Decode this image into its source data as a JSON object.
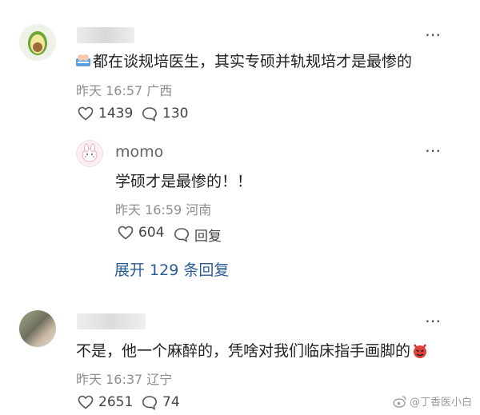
{
  "comments": [
    {
      "content": "都在谈规培医生，其实专硕并轨规培才是最惨的",
      "time": "昨天 16:57",
      "location": "广西",
      "likes": "1439",
      "comments": "130",
      "reply": {
        "username": "momo",
        "content": "学硕才是最惨的！！",
        "time": "昨天 16:59",
        "location": "河南",
        "likes": "604",
        "reply_label": "回复"
      },
      "expand_label": "展开 129 条回复"
    },
    {
      "content": "不是，他一个麻醉的，凭啥对我们临床指手画脚的",
      "time": "昨天 16:37",
      "location": "辽宁",
      "likes": "2651",
      "comments": "74"
    }
  ],
  "more_glyph": "⋯",
  "watermark": "@丁香医小白",
  "colors": {
    "link": "#2b5c97",
    "meta": "#8e8e8e",
    "avocado": "#8bbd3c"
  }
}
